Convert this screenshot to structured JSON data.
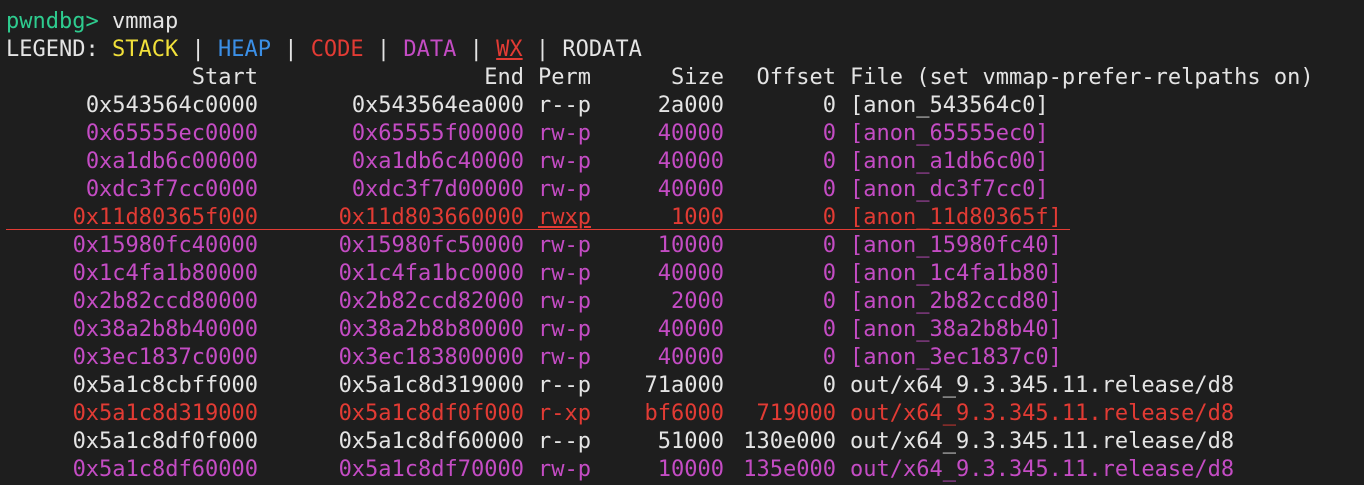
{
  "prompt": {
    "label": "pwndbg>",
    "command": "vmmap"
  },
  "legend": {
    "prefix": "LEGEND:",
    "separator": "|",
    "stack": "STACK",
    "heap": "HEAP",
    "code": "CODE",
    "data": "DATA",
    "wx": "WX",
    "rodata": "RODATA"
  },
  "header": {
    "start": "Start",
    "end": "End",
    "perm": "Perm",
    "size": "Size",
    "offset": "Offset",
    "file": "File (set vmmap-prefer-relpaths on)"
  },
  "rows": [
    {
      "kind": "rodata",
      "start": "0x543564c0000",
      "end": "0x543564ea000",
      "perm": "r--p",
      "size": "2a000",
      "offset": "0",
      "file": "[anon_543564c0]"
    },
    {
      "kind": "data",
      "start": "0x65555ec0000",
      "end": "0x65555f00000",
      "perm": "rw-p",
      "size": "40000",
      "offset": "0",
      "file": "[anon_65555ec0]"
    },
    {
      "kind": "data",
      "start": "0xa1db6c00000",
      "end": "0xa1db6c40000",
      "perm": "rw-p",
      "size": "40000",
      "offset": "0",
      "file": "[anon_a1db6c00]"
    },
    {
      "kind": "data",
      "start": "0xdc3f7cc0000",
      "end": "0xdc3f7d00000",
      "perm": "rw-p",
      "size": "40000",
      "offset": "0",
      "file": "[anon_dc3f7cc0]"
    },
    {
      "kind": "wx",
      "start": "0x11d80365f000",
      "end": "0x11d803660000",
      "perm": "rwxp",
      "size": "1000",
      "offset": "0",
      "file": "[anon_11d80365f]"
    },
    {
      "kind": "data",
      "start": "0x15980fc40000",
      "end": "0x15980fc50000",
      "perm": "rw-p",
      "size": "10000",
      "offset": "0",
      "file": "[anon_15980fc40]"
    },
    {
      "kind": "data",
      "start": "0x1c4fa1b80000",
      "end": "0x1c4fa1bc0000",
      "perm": "rw-p",
      "size": "40000",
      "offset": "0",
      "file": "[anon_1c4fa1b80]"
    },
    {
      "kind": "data",
      "start": "0x2b82ccd80000",
      "end": "0x2b82ccd82000",
      "perm": "rw-p",
      "size": "2000",
      "offset": "0",
      "file": "[anon_2b82ccd80]"
    },
    {
      "kind": "data",
      "start": "0x38a2b8b40000",
      "end": "0x38a2b8b80000",
      "perm": "rw-p",
      "size": "40000",
      "offset": "0",
      "file": "[anon_38a2b8b40]"
    },
    {
      "kind": "data",
      "start": "0x3ec1837c0000",
      "end": "0x3ec183800000",
      "perm": "rw-p",
      "size": "40000",
      "offset": "0",
      "file": "[anon_3ec1837c0]"
    },
    {
      "kind": "rodata",
      "start": "0x5a1c8cbff000",
      "end": "0x5a1c8d319000",
      "perm": "r--p",
      "size": "71a000",
      "offset": "0",
      "file": "out/x64_9.3.345.11.release/d8"
    },
    {
      "kind": "code",
      "start": "0x5a1c8d319000",
      "end": "0x5a1c8df0f000",
      "perm": "r-xp",
      "size": "bf6000",
      "offset": "719000",
      "file": "out/x64_9.3.345.11.release/d8"
    },
    {
      "kind": "rodata",
      "start": "0x5a1c8df0f000",
      "end": "0x5a1c8df60000",
      "perm": "r--p",
      "size": "51000",
      "offset": "130e000",
      "file": "out/x64_9.3.345.11.release/d8"
    },
    {
      "kind": "data",
      "start": "0x5a1c8df60000",
      "end": "0x5a1c8df70000",
      "perm": "rw-p",
      "size": "10000",
      "offset": "135e000",
      "file": "out/x64_9.3.345.11.release/d8"
    }
  ],
  "colors": {
    "background": "#1e1e1e",
    "prompt": "#2ecc8f",
    "stack": "#f1e03a",
    "heap": "#3b8fe6",
    "code": "#e23b34",
    "data": "#c44cc4",
    "wx": "#e23b34",
    "rodata": "#e4e4e4"
  }
}
